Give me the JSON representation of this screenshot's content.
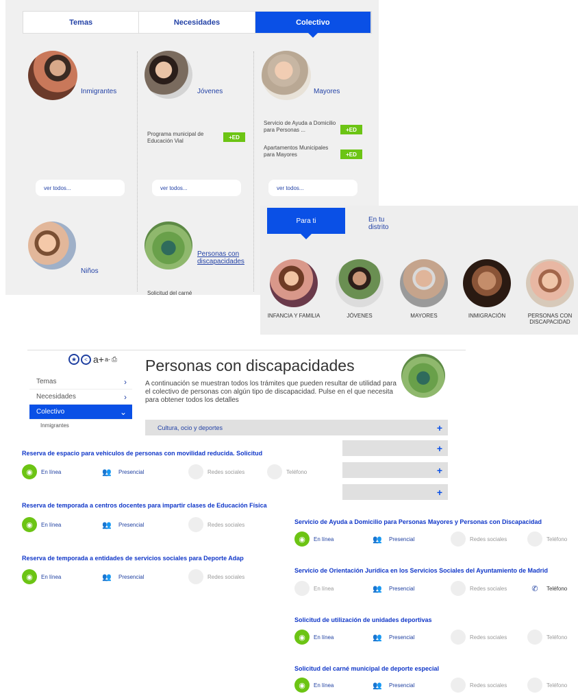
{
  "panel1": {
    "tabs": [
      "Temas",
      "Necesidades",
      "Colectivo"
    ],
    "columns": [
      {
        "label": "Inmigrantes",
        "items": [],
        "ver_todos": "ver todos..."
      },
      {
        "label": "Jóvenes",
        "items": [
          {
            "text": "Programa municipal de Educación Vial",
            "badge": "+ED"
          }
        ],
        "ver_todos": "ver todos..."
      },
      {
        "label": "Mayores",
        "items": [
          {
            "text": "Servicio de Ayuda a Domicilio para Personas ...",
            "badge": "+ED"
          },
          {
            "text": "Apartamentos Municipales para Mayores",
            "badge": "+ED"
          }
        ],
        "ver_todos": "ver todos..."
      }
    ],
    "row2": [
      {
        "label": "Niños"
      },
      {
        "label": "Personas con discapacidades",
        "item": "Solicitud del carné"
      }
    ]
  },
  "panel2": {
    "tabs": [
      "Para ti",
      "En tu distrito"
    ],
    "groups": [
      "INFANCIA Y FAMILIA",
      "JÓVENES",
      "MAYORES",
      "INMIGRACIÓN",
      "PERSONAS CON DISCAPACIDAD"
    ]
  },
  "panel3": {
    "toolbar": {
      "font_larger": "a+",
      "font_smaller": "a-"
    },
    "sidebar": {
      "items": [
        "Temas",
        "Necesidades",
        "Colectivo"
      ],
      "sub": "Inmigrantes"
    },
    "title": "Personas con discapacidades",
    "description": "A continuación se muestran todos los trámites que pueden resultar de utilidad para el colectivo de personas con algún tipo de discapacidad. Pulse en el que necesita para obtener todos los detalles",
    "accordion": [
      {
        "label": "Cultura, ocio y deportes",
        "plus": "+"
      },
      {
        "label": "",
        "plus": "+"
      },
      {
        "label": "",
        "plus": "+"
      },
      {
        "label": "",
        "plus": "+"
      }
    ],
    "channels": {
      "online": "En línea",
      "presencial": "Presencial",
      "redes": "Redes sociales",
      "telefono": "Teléfono"
    },
    "procedures_left": [
      "Reserva de espacio para vehiculos de personas con movilidad reducida. Solicitud",
      "Reserva de temporada a centros docentes para impartir clases de Educación Física",
      "Reserva de temporada a entidades de servicios sociales para Deporte Adap"
    ],
    "procedures_right": [
      "Servicio de Ayuda a Domicilio para Personas Mayores y Personas con Discapacidad",
      "Servicio de Orientación Jurídica en los Servicios Sociales del Ayuntamiento de Madrid",
      "Solicitud de utilización de unidades deportivas",
      "Solicitud del carné municipal de deporte especial"
    ]
  }
}
